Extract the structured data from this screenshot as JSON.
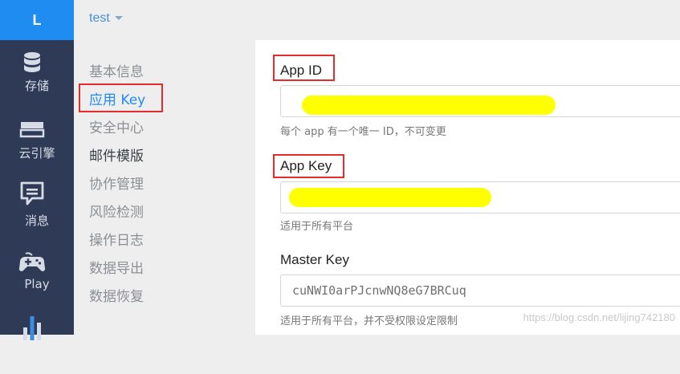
{
  "rail": {
    "logo": "L",
    "items": [
      {
        "label": "存储",
        "icon": "database-icon"
      },
      {
        "label": "云引擎",
        "icon": "server-icon"
      },
      {
        "label": "消息",
        "icon": "message-icon"
      },
      {
        "label": "Play",
        "icon": "gamepad-icon"
      },
      {
        "label": "",
        "icon": "bar-chart-icon"
      }
    ]
  },
  "header": {
    "app_name": "test"
  },
  "subnav": {
    "items": [
      "基本信息",
      "应用 Key",
      "安全中心",
      "邮件模版",
      "协作管理",
      "风险检测",
      "操作日志",
      "数据导出",
      "数据恢复"
    ],
    "active": "应用 Key"
  },
  "fields": {
    "app_id": {
      "label": "App ID",
      "value": "",
      "helper": "每个 app 有一个唯一 ID，不可变更"
    },
    "app_key": {
      "label": "App Key",
      "value": "",
      "helper": "适用于所有平台"
    },
    "master_key": {
      "label": "Master Key",
      "value": "cuNWI0arPJcnwNQ8eG7BRCuq",
      "helper": "适用于所有平台，并不受权限设定限制"
    }
  },
  "watermark": "https://blog.csdn.net/lijing742180",
  "colors": {
    "rail_bg": "#2f3a56",
    "accent": "#1e8cf0",
    "highlight_box": "#e32c2c",
    "redaction": "#ffff00"
  }
}
